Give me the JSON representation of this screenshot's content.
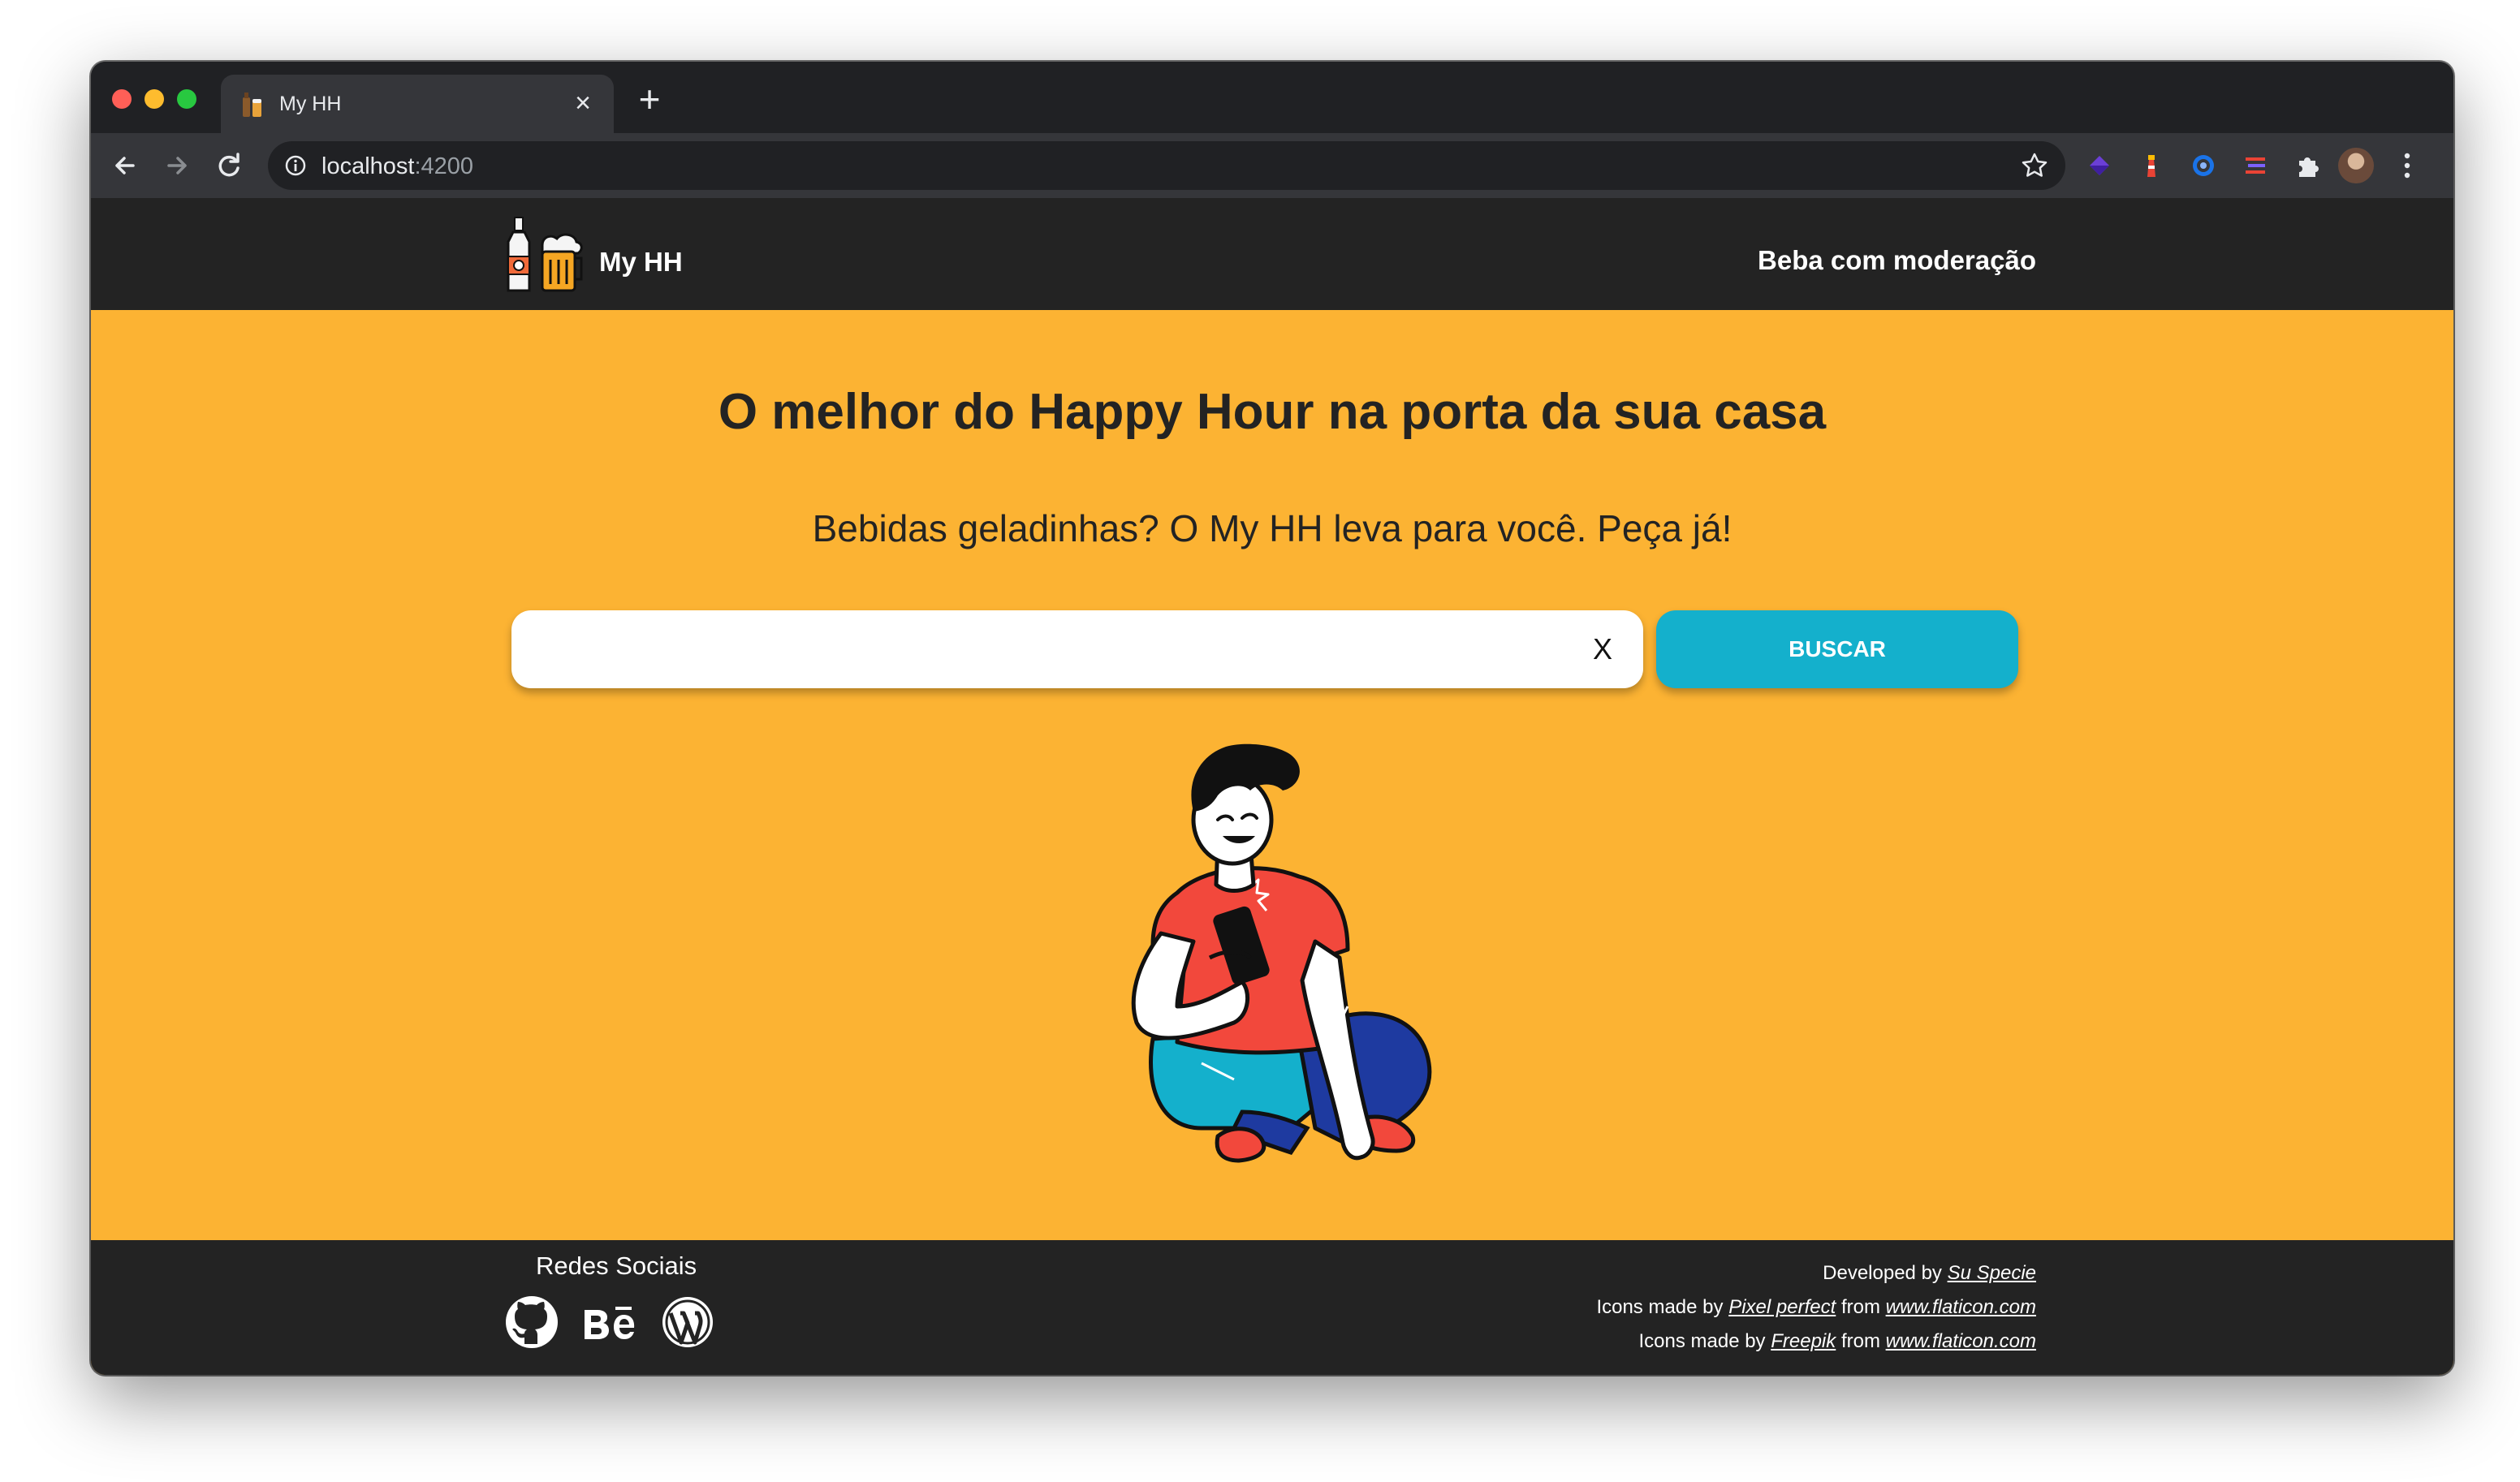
{
  "browser": {
    "tab_title": "My HH",
    "tab_close": "×",
    "new_tab": "+",
    "url_host": "localhost",
    "url_port": ":4200"
  },
  "header": {
    "brand": "My HH",
    "nav_link": "Beba com moderação"
  },
  "hero": {
    "title": "O melhor do Happy Hour na porta da sua casa",
    "subtitle": "Bebidas geladinhas? O My HH leva para você. Peça já!"
  },
  "search": {
    "value": "",
    "placeholder": "",
    "clear_label": "X",
    "button_label": "BUSCAR"
  },
  "footer": {
    "social_title": "Redes Sociais",
    "social_icons": [
      "github-icon",
      "behance-icon",
      "wordpress-icon"
    ],
    "credits": [
      {
        "prefix": "Developed by",
        "author": "Su Specie",
        "from_text": "",
        "site": ""
      },
      {
        "prefix": "Icons made by",
        "author": "Pixel perfect",
        "from_text": "from",
        "site": "www.flaticon.com"
      },
      {
        "prefix": "Icons made by",
        "author": "Freepik",
        "from_text": "from",
        "site": "www.flaticon.com"
      }
    ]
  },
  "colors": {
    "background": "#fcb333",
    "header_footer": "#232323",
    "button": "#14b0cc",
    "browser_chrome": "#202124"
  }
}
